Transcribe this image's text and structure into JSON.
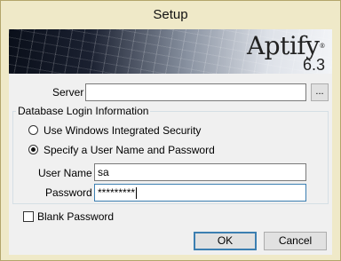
{
  "window": {
    "title": "Setup"
  },
  "banner": {
    "logo_text": "Aptify",
    "logo_mark": "®",
    "version": "6.3"
  },
  "server": {
    "label": "Server",
    "value": "",
    "browse_label": "..."
  },
  "db_login": {
    "legend": "Database Login Information",
    "option_windows": "Use Windows Integrated Security",
    "option_user": "Specify a User Name and Password",
    "selected": "user",
    "username_label": "User Name",
    "username_value": "sa",
    "password_label": "Password",
    "password_value": "*********"
  },
  "blank_password": {
    "label": "Blank Password",
    "checked": false
  },
  "buttons": {
    "ok": "OK",
    "cancel": "Cancel"
  }
}
